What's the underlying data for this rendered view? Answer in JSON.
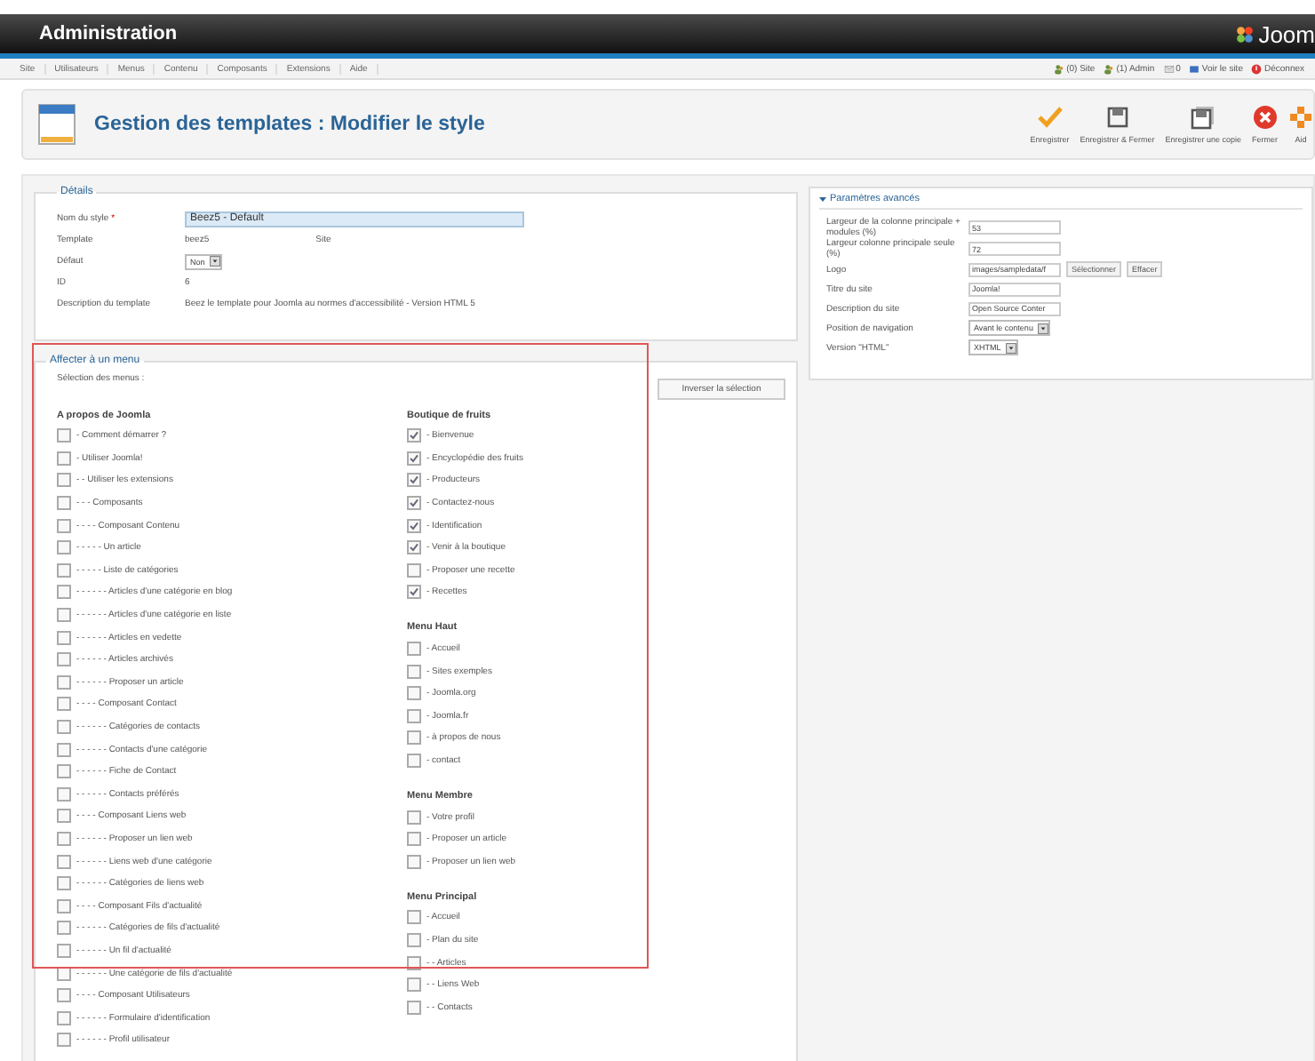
{
  "header": {
    "title": "Administration",
    "logo": "Joom"
  },
  "menu": {
    "items": [
      "Site",
      "Utilisateurs",
      "Menus",
      "Contenu",
      "Composants",
      "Extensions",
      "Aide"
    ],
    "status": [
      {
        "kind": "users",
        "label": "(0) Site"
      },
      {
        "kind": "users",
        "label": "(1) Admin"
      },
      {
        "kind": "mail",
        "label": "0"
      },
      {
        "kind": "screen",
        "label": "Voir le site"
      },
      {
        "kind": "power",
        "label": "Déconnex"
      }
    ]
  },
  "toolbar": {
    "title": "Gestion des templates : Modifier le style",
    "buttons": [
      {
        "kind": "save",
        "label": "Enregistrer"
      },
      {
        "kind": "save-close",
        "label": "Enregistrer & Fermer"
      },
      {
        "kind": "copy",
        "label": "Enregistrer une copie"
      },
      {
        "kind": "close",
        "label": "Fermer"
      },
      {
        "kind": "help",
        "label": "Aid"
      }
    ]
  },
  "details": {
    "legend": "Détails",
    "fields": [
      {
        "kind": "input",
        "label": "Nom du style",
        "required_mark": "*",
        "value": "Beez5 - Default"
      },
      {
        "kind": "text",
        "label": "Template",
        "value": "beez5",
        "extra": "Site"
      },
      {
        "kind": "select",
        "label": "Défaut",
        "value": "Non"
      },
      {
        "kind": "text",
        "label": "ID",
        "value": "6"
      },
      {
        "kind": "text",
        "label": "Description du template",
        "value": "Beez le template pour Joomla au normes d'accessibilité - Version HTML 5"
      }
    ]
  },
  "assign": {
    "legend": "Affecter à un menu",
    "subtitle": "Sélection des menus :",
    "invert_button": "Inverser la sélection",
    "columns": [
      [
        {
          "title": "A propos de Joomla",
          "items": [
            {
              "label": "- Comment démarrer ?",
              "checked": false
            },
            {
              "label": "- Utiliser Joomla!",
              "checked": false
            },
            {
              "label": "- - Utiliser les extensions",
              "checked": false
            },
            {
              "label": "- - - Composants",
              "checked": false
            },
            {
              "label": "- - - - Composant Contenu",
              "checked": false
            },
            {
              "label": "- - - - - Un article",
              "checked": false
            },
            {
              "label": "- - - - - Liste de catégories",
              "checked": false
            },
            {
              "label": "- - - - - - Articles d'une catégorie en blog",
              "checked": false
            },
            {
              "label": "- - - - - - Articles d'une catégorie en liste",
              "checked": false
            },
            {
              "label": "- - - - - - Articles en vedette",
              "checked": false
            },
            {
              "label": "- - - - - - Articles archivés",
              "checked": false
            },
            {
              "label": "- - - - - - Proposer un article",
              "checked": false
            },
            {
              "label": "- - - - Composant Contact",
              "checked": false
            },
            {
              "label": "- - - - - - Catégories de contacts",
              "checked": false
            },
            {
              "label": "- - - - - - Contacts d'une catégorie",
              "checked": false
            },
            {
              "label": "- - - - - - Fiche de Contact",
              "checked": false
            },
            {
              "label": "- - - - - - Contacts préférés",
              "checked": false
            },
            {
              "label": "- - - - Composant Liens web",
              "checked": false
            },
            {
              "label": "- - - - - - Proposer un lien web",
              "checked": false
            },
            {
              "label": "- - - - - - Liens web d'une catégorie",
              "checked": false
            },
            {
              "label": "- - - - - - Catégories de liens web",
              "checked": false
            },
            {
              "label": "- - - - Composant Fils d'actualité",
              "checked": false
            },
            {
              "label": "- - - - - - Catégories de fils d'actualité",
              "checked": false
            },
            {
              "label": "- - - - - - Un fil d'actualité",
              "checked": false
            },
            {
              "label": "- - - - - - Une catégorie de fils d'actualité",
              "checked": false
            },
            {
              "label": "- - - - Composant Utilisateurs",
              "checked": false
            },
            {
              "label": "- - - - - - Formulaire d'identification",
              "checked": false
            },
            {
              "label": "- - - - - - Profil utilisateur",
              "checked": false
            }
          ]
        }
      ],
      [
        {
          "title": "Boutique de fruits",
          "items": [
            {
              "label": "- Bienvenue",
              "checked": true
            },
            {
              "label": "- Encyclopédie des fruits",
              "checked": true
            },
            {
              "label": "- Producteurs",
              "checked": true
            },
            {
              "label": "- Contactez-nous",
              "checked": true
            },
            {
              "label": "- Identification",
              "checked": true
            },
            {
              "label": "- Venir à la boutique",
              "checked": true
            },
            {
              "label": "- Proposer une recette",
              "checked": false
            },
            {
              "label": "- Recettes",
              "checked": true
            }
          ]
        },
        {
          "title": "Menu Haut",
          "items": [
            {
              "label": "- Accueil",
              "checked": false
            },
            {
              "label": "- Sites exemples",
              "checked": false
            },
            {
              "label": "- Joomla.org",
              "checked": false
            },
            {
              "label": "- Joomla.fr",
              "checked": false
            },
            {
              "label": "- à propos de nous",
              "checked": false
            },
            {
              "label": "- contact",
              "checked": false
            }
          ]
        },
        {
          "title": "Menu Membre",
          "items": [
            {
              "label": "- Votre profil",
              "checked": false
            },
            {
              "label": "- Proposer un article",
              "checked": false
            },
            {
              "label": "- Proposer un lien web",
              "checked": false
            }
          ]
        },
        {
          "title": "Menu Principal",
          "items": [
            {
              "label": "- Accueil",
              "checked": false
            },
            {
              "label": "- Plan du site",
              "checked": false
            },
            {
              "label": "- - Articles",
              "checked": false
            },
            {
              "label": "- - Liens Web",
              "checked": false
            },
            {
              "label": "- - Contacts",
              "checked": false
            }
          ]
        }
      ]
    ]
  },
  "advanced": {
    "title": "Paramètres avancés",
    "expanded": true,
    "fields": [
      {
        "kind": "input",
        "label": "Largeur de la colonne principale + modules (%)",
        "value": "53"
      },
      {
        "kind": "input",
        "label": "Largeur colonne principale seule (%)",
        "value": "72"
      },
      {
        "kind": "media",
        "label": "Logo",
        "value": "images/sampledata/f",
        "buttons": [
          "Sélectionner",
          "Effacer"
        ]
      },
      {
        "kind": "input",
        "label": "Titre du site",
        "value": "Joomla!"
      },
      {
        "kind": "input",
        "label": "Description du site",
        "value": "Open Source Conter"
      },
      {
        "kind": "select",
        "label": "Position de navigation",
        "value": "Avant le contenu"
      },
      {
        "kind": "select",
        "label": "Version \"HTML\"",
        "value": "XHTML"
      }
    ]
  }
}
